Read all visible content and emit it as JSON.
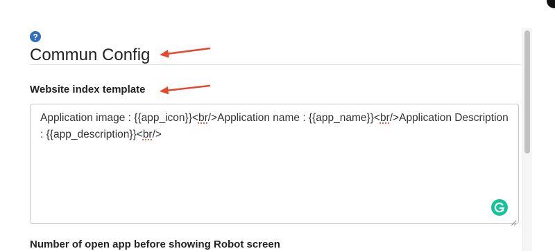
{
  "section": {
    "help_icon": "question-circle-icon",
    "title": "Commun Config"
  },
  "website_index": {
    "label": "Website index template",
    "value_parts": [
      "Application image : {{app_icon}}<",
      "br",
      "/>Application name : {{app_name}}<",
      "br",
      "/>Application Description : {{app_description}}<",
      "br",
      "/>"
    ]
  },
  "next_field": {
    "label": "Number of open app before showing Robot screen"
  },
  "colors": {
    "arrow": "#e8462f",
    "help_icon": "#2f6fbf",
    "grammarly": "#15c39a"
  }
}
